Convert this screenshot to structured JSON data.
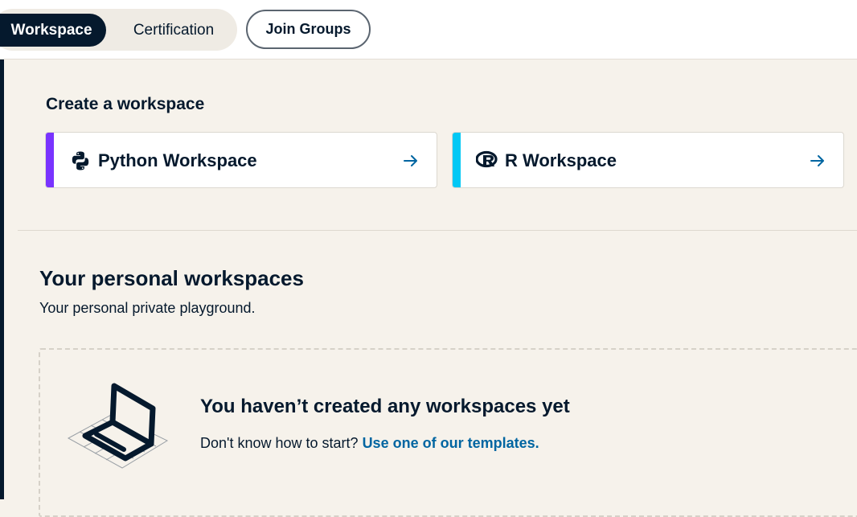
{
  "tabs": {
    "active_label": "Workspace",
    "other_label": "Certification"
  },
  "header": {
    "join_groups_label": "Join Groups"
  },
  "create": {
    "title": "Create a workspace",
    "cards": [
      {
        "label": "Python Workspace",
        "icon": "python-icon",
        "accent": "#7933ff",
        "arrow": "arrow-right-icon"
      },
      {
        "label": "R Workspace",
        "icon": "r-logo-icon",
        "accent": "#03ef62",
        "arrow": "arrow-right-icon"
      }
    ]
  },
  "personal": {
    "title": "Your personal workspaces",
    "subtitle": "Your personal private playground.",
    "empty_title": "You haven’t created any workspaces yet",
    "empty_prompt": "Don't know how to start?",
    "empty_link": "Use one of our templates."
  },
  "colors": {
    "navy": "#05192d",
    "link_blue": "#0065a1",
    "arrow_blue": "#0065a1",
    "python_accent": "#7933ff",
    "r_accent": "#03c8f5",
    "page_bg": "#f6f2eb"
  }
}
